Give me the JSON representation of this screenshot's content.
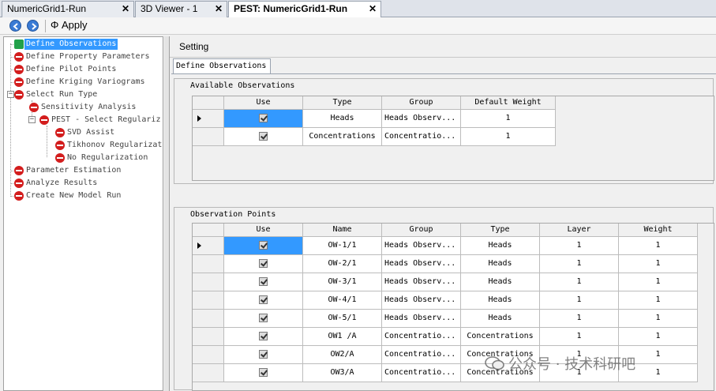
{
  "tabs": [
    {
      "label": "NumericGrid1-Run",
      "close": "✕"
    },
    {
      "label": "3D Viewer - 1",
      "close": "✕"
    },
    {
      "label": "PEST: NumericGrid1-Run",
      "close": "✕"
    }
  ],
  "toolbar": {
    "apply_label": "Φ Apply"
  },
  "tree": [
    {
      "label": "Define Observations"
    },
    {
      "label": "Define Property Parameters"
    },
    {
      "label": "Define Pilot Points"
    },
    {
      "label": "Define Kriging Variograms"
    },
    {
      "label": "Select Run Type"
    },
    {
      "label": "Sensitivity Analysis"
    },
    {
      "label": "PEST - Select Regulariz"
    },
    {
      "label": "SVD Assist"
    },
    {
      "label": "Tikhonov Regularizat"
    },
    {
      "label": "No Regularization"
    },
    {
      "label": "Parameter Estimation"
    },
    {
      "label": "Analyze Results"
    },
    {
      "label": "Create New Model Run"
    }
  ],
  "panel": {
    "title": "Setting",
    "tab_label": "Define Observations"
  },
  "available": {
    "title": "Available Observations",
    "headers": [
      "Use",
      "Type",
      "Group",
      "Default Weight"
    ],
    "rows": [
      {
        "type": "Heads",
        "group": "Heads Observ...",
        "weight": "1"
      },
      {
        "type": "Concentrations",
        "group": "Concentratio...",
        "weight": "1"
      }
    ]
  },
  "points": {
    "title": "Observation Points",
    "headers": [
      "Use",
      "Name",
      "Group",
      "Type",
      "Layer",
      "Weight"
    ],
    "rows": [
      {
        "name": "OW-1/1",
        "group": "Heads Observ...",
        "type": "Heads",
        "layer": "1",
        "weight": "1"
      },
      {
        "name": "OW-2/1",
        "group": "Heads Observ...",
        "type": "Heads",
        "layer": "1",
        "weight": "1"
      },
      {
        "name": "OW-3/1",
        "group": "Heads Observ...",
        "type": "Heads",
        "layer": "1",
        "weight": "1"
      },
      {
        "name": "OW-4/1",
        "group": "Heads Observ...",
        "type": "Heads",
        "layer": "1",
        "weight": "1"
      },
      {
        "name": "OW-5/1",
        "group": "Heads Observ...",
        "type": "Heads",
        "layer": "1",
        "weight": "1"
      },
      {
        "name": "OW1 /A",
        "group": "Concentratio...",
        "type": "Concentrations",
        "layer": "1",
        "weight": "1"
      },
      {
        "name": "OW2/A",
        "group": "Concentratio...",
        "type": "Concentrations",
        "layer": "1",
        "weight": "1"
      },
      {
        "name": "OW3/A",
        "group": "Concentratio...",
        "type": "Concentrations",
        "layer": "1",
        "weight": "1"
      }
    ]
  },
  "watermark": "公众号 · 技术科研吧"
}
